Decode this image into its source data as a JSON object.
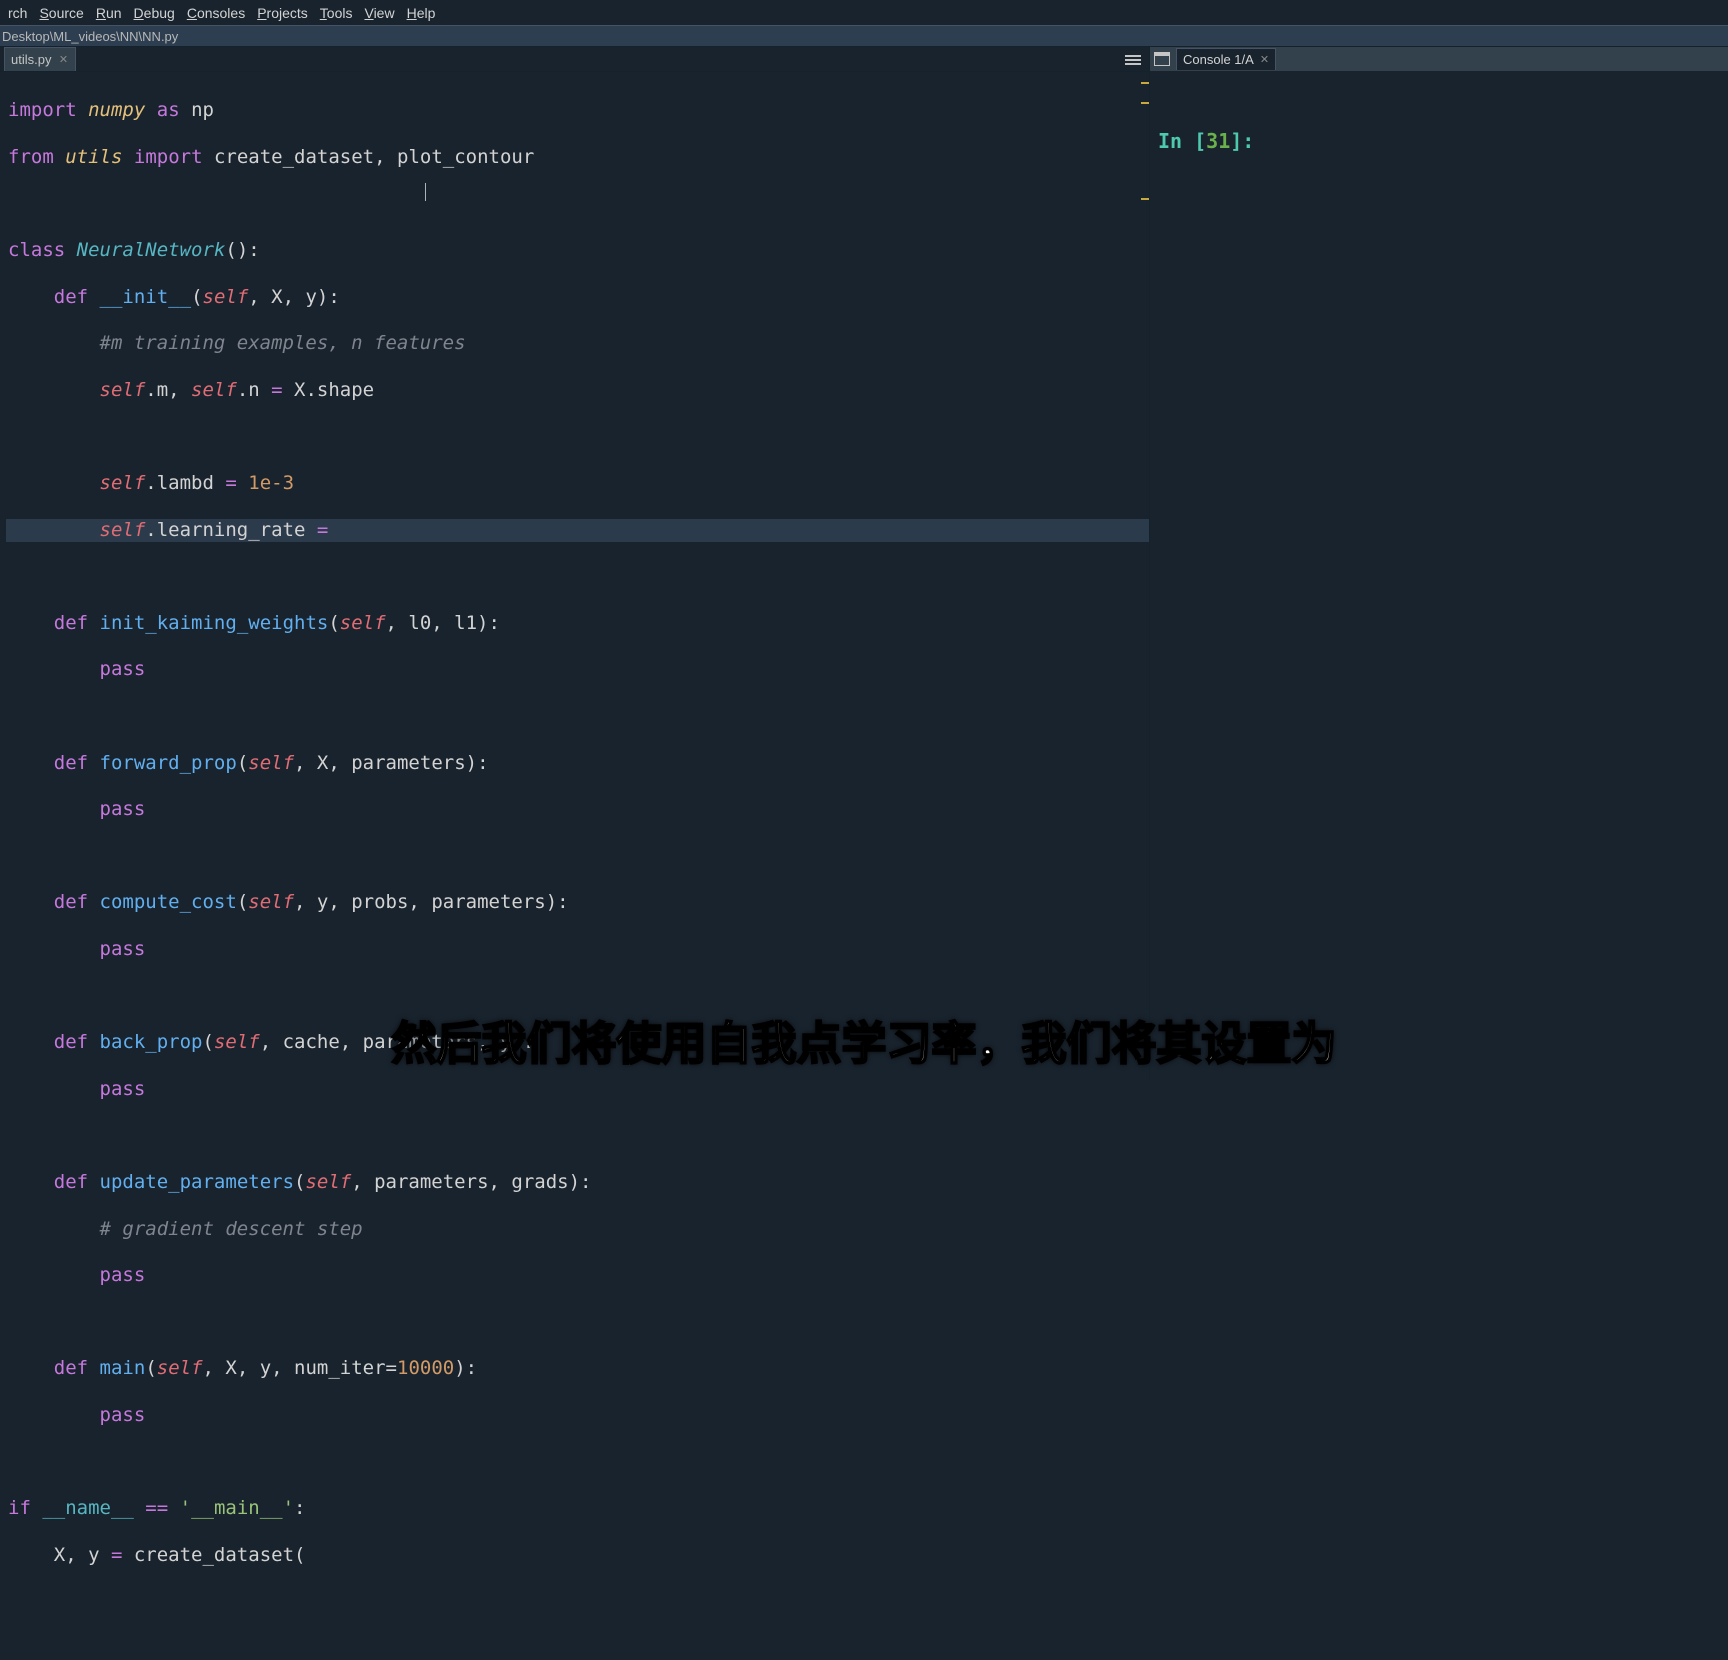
{
  "menubar": [
    "rch",
    "Source",
    "Run",
    "Debug",
    "Consoles",
    "Projects",
    "Tools",
    "View",
    "Help"
  ],
  "menubar_underline_idx": [
    -1,
    0,
    0,
    0,
    0,
    0,
    0,
    0,
    0
  ],
  "filepath": "Desktop\\ML_videos\\NN\\NN.py",
  "tab": {
    "name": "utils.py"
  },
  "console_tab": "Console 1/A",
  "console_prompt": {
    "in": "In ",
    "open": "[",
    "idx": "31",
    "close": "]:"
  },
  "subtitle": "然后我们将使用自我点学习率，我们将其设置为",
  "code": {
    "l1_import": "import",
    "l1_mod": "numpy",
    "l1_as": "as",
    "l1_alias": "np",
    "l2_from": "from",
    "l2_mod": "utils",
    "l2_import": "import",
    "l2_n1": "create_dataset",
    "l2_n2": "plot_contour",
    "l4_class": "class",
    "l4_name": "NeuralNetwork",
    "l5_def": "def",
    "l5_name": "__init__",
    "l5_self": "self",
    "l5_p": ", X, y):",
    "l6_cmt": "#m training examples, n features",
    "l7_self1": "self",
    "l7_a": ".m, ",
    "l7_self2": "self",
    "l7_b": ".n ",
    "l7_eq": "=",
    "l7_c": " X.shape",
    "l9_self": "self",
    "l9_a": ".lambd ",
    "l9_eq": "=",
    "l9_num": "1e-3",
    "l10_self": "self",
    "l10_a": ".learning_rate ",
    "l10_eq": "=",
    "l12_def": "def",
    "l12_name": "init_kaiming_weights",
    "l12_self": "self",
    "l12_p": ", l0, l1):",
    "l13_pass": "pass",
    "l15_def": "def",
    "l15_name": "forward_prop",
    "l15_self": "self",
    "l15_p": ", X, parameters):",
    "l16_pass": "pass",
    "l18_def": "def",
    "l18_name": "compute_cost",
    "l18_self": "self",
    "l18_p": ", y, probs, parameters):",
    "l19_pass": "pass",
    "l21_def": "def",
    "l21_name": "back_prop",
    "l21_self": "self",
    "l21_p": ", cache, parameters, y):",
    "l22_pass": "pass",
    "l24_def": "def",
    "l24_name": "update_parameters",
    "l24_self": "self",
    "l24_p": ", parameters, grads):",
    "l25_cmt": "# gradient descent step",
    "l26_pass": "pass",
    "l28_def": "def",
    "l28_name": "main",
    "l28_self": "self",
    "l28_p": ", X, y, num_iter=",
    "l28_num": "10000",
    "l28_p2": "):",
    "l29_pass": "pass",
    "l31_if": "if",
    "l31_name": "__name__",
    "l31_eq": " == ",
    "l31_str": "'__main__'",
    "l31_colon": ":",
    "l32_a": "X, y ",
    "l32_eq": "=",
    "l32_b": " create_dataset("
  }
}
